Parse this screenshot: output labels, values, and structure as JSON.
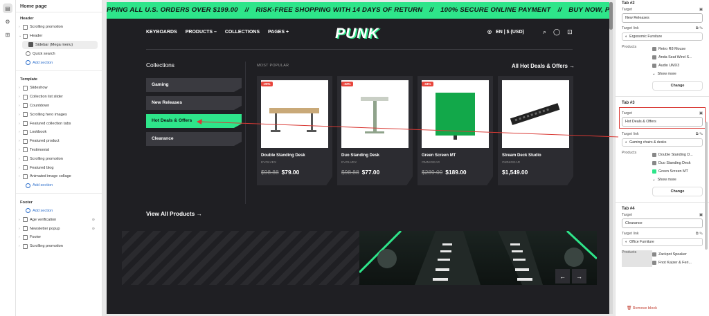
{
  "left_panel": {
    "title": "Home page",
    "header_section": "Header",
    "header_items": [
      "Scrolling promotion",
      "Header"
    ],
    "header_sub": "Sidebar (Mega menu)",
    "header_sub2": "Quick search",
    "add_section": "Add section",
    "template_section": "Template",
    "template_items": [
      "Slideshow",
      "Collection list slider",
      "Countdown",
      "Scrolling hero images",
      "Featured collection tabs",
      "Lookbook",
      "Featured product",
      "Testimonial",
      "Scrolling promotion",
      "Featured blog",
      "Animated image collage"
    ],
    "footer_section": "Footer",
    "footer_items": [
      "Age verification",
      "Newsletter popup",
      "Footer",
      "Scrolling promotion"
    ]
  },
  "preview": {
    "announcement": [
      "PPING ALL U.S. ORDERS OVER $199.00",
      "//",
      "RISK-FREE SHOPPING WITH 14 DAYS OF RETURN",
      "//",
      "100% SECURE ONLINE PAYMENT",
      "//",
      "BUY NOW, PAY LATER WITH SHOP PAY"
    ],
    "nav": [
      "KEYBOARDS",
      "PRODUCTS –",
      "COLLECTIONS",
      "PAGES +"
    ],
    "logo": "PUNK",
    "locale": "EN | $ (USD)",
    "collections_title": "Collections",
    "tabs": [
      "Gaming",
      "New Releases",
      "Hot Deals & Offers",
      "Clearance"
    ],
    "active_tab_index": 2,
    "most_popular": "MOST POPULAR",
    "all_link": "All Hot Deals & Offers →",
    "view_all": "View All Products →",
    "products": [
      {
        "name": "Double Standing Desk",
        "vendor": "EVOLVEX",
        "old": "$98.88",
        "price": "$79.00",
        "badge": "-20%"
      },
      {
        "name": "Duo Standing Desk",
        "vendor": "EVOLVEX",
        "old": "$98.88",
        "price": "$77.00",
        "badge": "-22%"
      },
      {
        "name": "Green Screen MT",
        "vendor": "OMNIGEAR",
        "old": "$289.00",
        "price": "$189.00",
        "badge": "-34%"
      },
      {
        "name": "Stream Deck Studio",
        "vendor": "OMNIGEAR",
        "old": "",
        "price": "$1,549.00",
        "badge": ""
      }
    ]
  },
  "right_panel": {
    "tab2": {
      "heading": "Tab #2",
      "target_label": "Target",
      "target_value": "New Releases",
      "link_label": "Target link",
      "link_value": "Ergonomic Furniture",
      "products_label": "Products",
      "products": [
        "Retro R8 Mouse",
        "Anda Seat Wind S...",
        "Audio UMX3"
      ],
      "show_more": "Show more",
      "change": "Change"
    },
    "tab3": {
      "heading": "Tab #3",
      "target_label": "Target",
      "target_value": "Hot Deals & Offers",
      "link_label": "Target link",
      "link_value": "Gaming chairs & desks",
      "products_label": "Products",
      "products": [
        "Double Standing D...",
        "Duo Standing Desk",
        "Green Screen MT"
      ],
      "show_more": "Show more",
      "change": "Change"
    },
    "tab4": {
      "heading": "Tab #4",
      "target_label": "Target",
      "target_value": "Clearance",
      "link_label": "Target link",
      "link_value": "Office Furniture",
      "products_label": "Products",
      "products": [
        "Zackpot Speaker",
        "Fnot Kaizer & Feri..."
      ]
    },
    "remove_block": "Remove block"
  },
  "colors": {
    "accent": "#2ee58a",
    "annotation": "#d93a35",
    "dark_bg": "#1f1f23"
  }
}
